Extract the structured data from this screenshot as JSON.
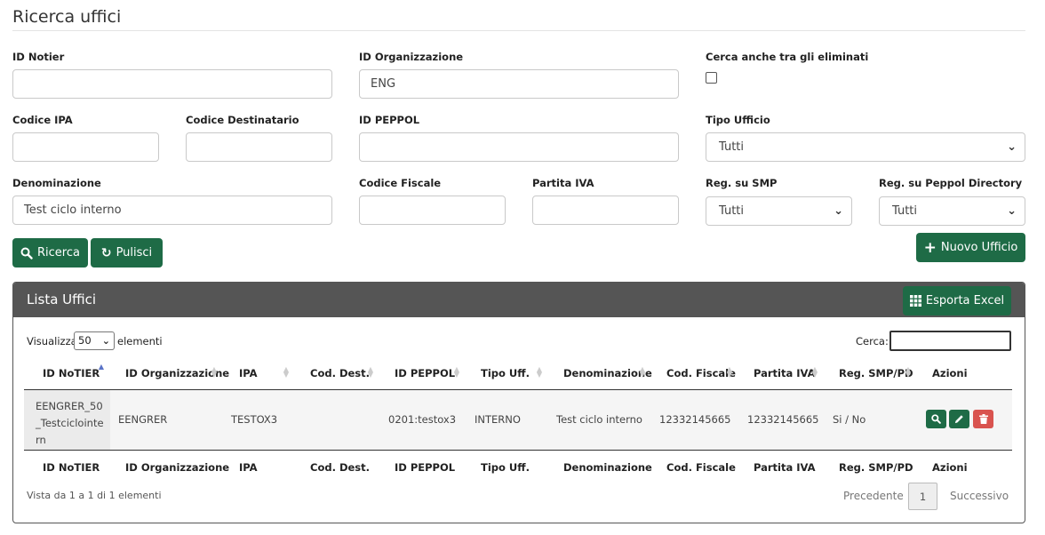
{
  "page": {
    "title": "Ricerca uffici"
  },
  "form": {
    "id_notier": {
      "label": "ID Notier",
      "value": ""
    },
    "id_organizzazione": {
      "label": "ID Organizzazione",
      "value": "ENG"
    },
    "cerca_eliminati": {
      "label": "Cerca anche tra gli eliminati",
      "checked": false
    },
    "codice_ipa": {
      "label": "Codice IPA",
      "value": ""
    },
    "codice_destinatario": {
      "label": "Codice Destinatario",
      "value": ""
    },
    "id_peppol": {
      "label": "ID PEPPOL",
      "value": ""
    },
    "tipo_ufficio": {
      "label": "Tipo Ufficio",
      "selected": "Tutti"
    },
    "denominazione": {
      "label": "Denominazione",
      "value": "Test ciclo interno"
    },
    "codice_fiscale": {
      "label": "Codice Fiscale",
      "value": ""
    },
    "partita_iva": {
      "label": "Partita IVA",
      "value": ""
    },
    "reg_smp": {
      "label": "Reg. su SMP",
      "selected": "Tutti"
    },
    "reg_peppol_directory": {
      "label": "Reg. su Peppol Directory",
      "selected": "Tutti"
    }
  },
  "buttons": {
    "ricerca": "Ricerca",
    "pulisci": "Pulisci",
    "nuovo_ufficio": "Nuovo Ufficio",
    "esporta_excel": "Esporta Excel"
  },
  "table_panel": {
    "title": "Lista Uffici",
    "length_prefix": "Visualizza",
    "length_value": "50",
    "length_suffix": "elementi",
    "search_label": "Cerca:",
    "search_value": "",
    "columns": [
      "ID NoTIER",
      "ID Organizzazione",
      "IPA",
      "Cod. Dest.",
      "ID PEPPOL",
      "Tipo Uff.",
      "Denominazione",
      "Cod. Fiscale",
      "Partita IVA",
      "Reg. SMP/PD",
      "Azioni"
    ],
    "rows": [
      {
        "id_notier_lines": [
          "EENGRER_50",
          "_Testciclointe",
          "rn"
        ],
        "id_organizzazione": "EENGRER",
        "ipa": "TESTOX3",
        "cod_dest": "",
        "id_peppol": "0201:testox3",
        "tipo_uff": "INTERNO",
        "denominazione": "Test ciclo interno",
        "cod_fiscale": "12332145665",
        "partita_iva": "12332145665",
        "reg_smp_pd": "Si / No"
      }
    ],
    "info": "Vista da 1 a 1 di 1 elementi",
    "pagination": {
      "prev": "Precedente",
      "current": "1",
      "next": "Successivo"
    }
  },
  "icons": {
    "search": "search-icon",
    "refresh": "refresh-icon",
    "plus": "plus-icon",
    "grid": "grid-icon",
    "edit": "pencil-icon",
    "delete": "trash-icon"
  },
  "colors": {
    "primary_green": "#1e6b46",
    "danger_red": "#d9534f",
    "panel_header": "#555555",
    "sort_active": "#5a73c7"
  }
}
